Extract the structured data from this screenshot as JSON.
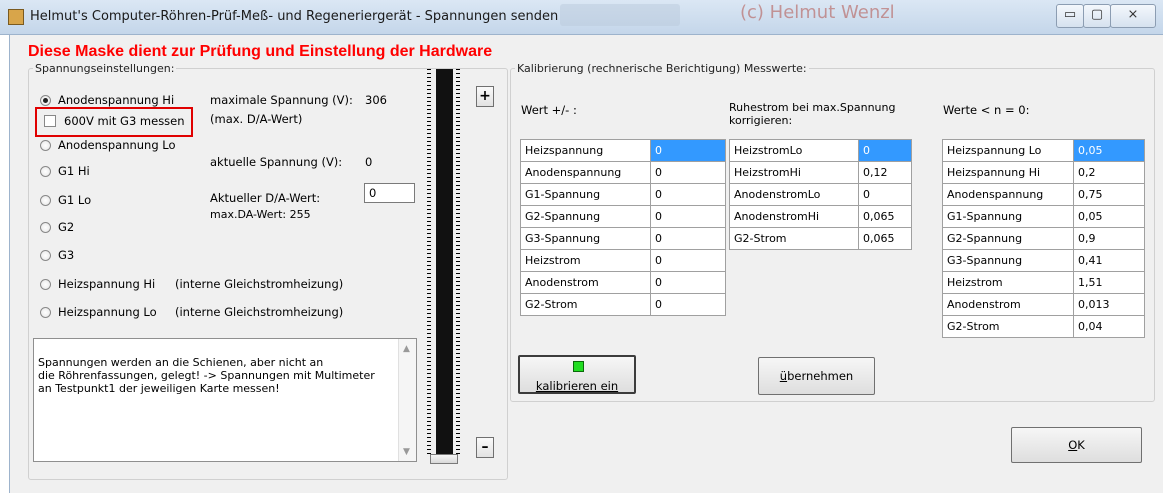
{
  "window": {
    "title": "Helmut's Computer-Röhren-Prüf-Meß- und Regeneriergerät - Spannungen senden",
    "ghost_text": "(c) Helmut Wenzl",
    "min_glyph": "▭",
    "max_glyph": "▢",
    "close_glyph": "⨯"
  },
  "heading": "Diese Maske dient zur Prüfung und Einstellung der Hardware",
  "voltage_group": {
    "legend": "Spannungseinstellungen:",
    "radios": [
      {
        "label": "Anodenspannung Hi",
        "checked": true
      },
      {
        "label": "Anodenspannung Lo",
        "checked": false
      },
      {
        "label": "G1 Hi",
        "checked": false
      },
      {
        "label": "G1 Lo",
        "checked": false
      },
      {
        "label": "G2",
        "checked": false
      },
      {
        "label": "G3",
        "checked": false
      },
      {
        "label": "Heizspannung Hi",
        "checked": false
      },
      {
        "label": "Heizspannung Lo",
        "checked": false
      }
    ],
    "checkbox_600v": {
      "label": "600V mit G3 messen",
      "checked": false
    },
    "max_voltage_label": "maximale Spannung (V):",
    "max_voltage_value": "306",
    "max_da_note": "(max. D/A-Wert)",
    "current_voltage_label": "aktuelle Spannung (V):",
    "current_voltage_value": "0",
    "current_da_label": "Aktueller D/A-Wert:",
    "max_da_label": "max.DA-Wert: 255",
    "da_input_value": "0",
    "heiz_hi_note": "(interne Gleichstromheizung)",
    "heiz_lo_note": "(interne Gleichstromheizung)",
    "memo_text": "Spannungen werden an die Schienen, aber nicht an\ndie Röhrenfassungen, gelegt! -> Spannungen mit Multimeter\nan Testpunkt1 der jeweiligen Karte messen!",
    "plus_label": "+",
    "minus_label": "–",
    "slider_value_fraction": 0
  },
  "calibration_group": {
    "legend": "Kalibrierung (rechnerische Berichtigung) Messwerte:",
    "col1_header": "Wert +/- :",
    "col2_header": "Ruhestrom bei max.Spannung\nkorrigieren:",
    "col3_header": "Werte < n = 0:",
    "table1": [
      [
        "Heizspannung",
        "0"
      ],
      [
        "Anodenspannung",
        "0"
      ],
      [
        "G1-Spannung",
        "0"
      ],
      [
        "G2-Spannung",
        "0"
      ],
      [
        "G3-Spannung",
        "0"
      ],
      [
        "Heizstrom",
        "0"
      ],
      [
        "Anodenstrom",
        "0"
      ],
      [
        "G2-Strom",
        "0"
      ]
    ],
    "table2": [
      [
        "HeizstromLo",
        "0"
      ],
      [
        "HeizstromHi",
        "0,12"
      ],
      [
        "AnodenstromLo",
        "0"
      ],
      [
        "AnodenstromHi",
        "0,065"
      ],
      [
        "G2-Strom",
        "0,065"
      ]
    ],
    "table3": [
      [
        "Heizspannung Lo",
        "0,05"
      ],
      [
        "Heizspannung Hi",
        "0,2"
      ],
      [
        "Anodenspannung",
        "0,75"
      ],
      [
        "G1-Spannung",
        "0,05"
      ],
      [
        "G2-Spannung",
        "0,9"
      ],
      [
        "G3-Spannung",
        "0,41"
      ],
      [
        "Heizstrom",
        "1,51"
      ],
      [
        "Anodenstrom",
        "0,013"
      ],
      [
        "G2-Strom",
        "0,04"
      ]
    ],
    "kalib_button_label": "kalibrieren ein",
    "kalib_led_color": "#22dd22",
    "uebernehmen_first": "ü",
    "uebernehmen_rest": "bernehmen"
  },
  "ok_first": "O",
  "ok_rest": "K",
  "accent_colors": {
    "heading": "#ff0000",
    "selection": "#3399ff",
    "highlight_box": "#e00000"
  }
}
